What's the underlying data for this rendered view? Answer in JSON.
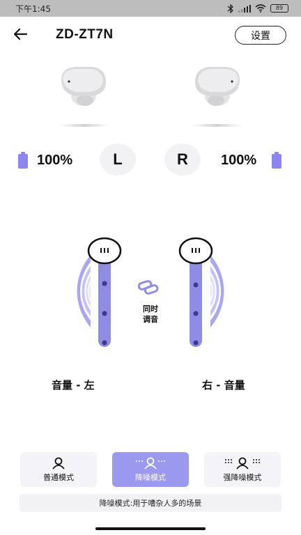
{
  "status_bar": {
    "time": "下午1:45",
    "battery": "89",
    "icons": [
      "bluetooth-icon",
      "signal-icon",
      "wifi-icon",
      "battery-icon"
    ]
  },
  "header": {
    "title": "ZD-ZT7N",
    "settings_label": "设置",
    "back_icon": "arrow-left-icon"
  },
  "earbuds": {
    "left": {
      "side": "L",
      "battery": "100%"
    },
    "right": {
      "side": "R",
      "battery": "100%"
    }
  },
  "volume": {
    "left_label": "音量 - 左",
    "right_label": "右 - 音量",
    "sync_label_line1": "同时",
    "sync_label_line2": "调音",
    "sync_icon": "link-icon"
  },
  "modes": [
    {
      "label": "普通模式",
      "icon": "person-icon",
      "active": false
    },
    {
      "label": "降噪模式",
      "icon": "person-noise-icon",
      "active": true
    },
    {
      "label": "强降噪模式",
      "icon": "person-strong-noise-icon",
      "active": false
    }
  ],
  "mode_description": "降噪模式:用于嘈杂人多的场景",
  "colors": {
    "accent": "#9b98ef",
    "slider": "#8f8ce6",
    "battery": "#8b87ef",
    "status_bar": "#bdbdbd"
  }
}
